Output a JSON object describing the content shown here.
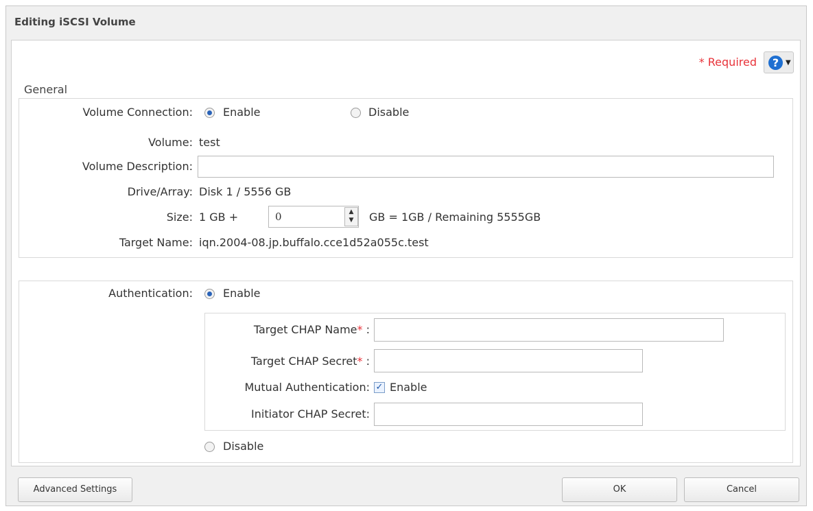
{
  "dialog": {
    "title": "Editing iSCSI Volume",
    "required_text": "Required",
    "required_star": "*",
    "help_icon": "question-circle-icon",
    "section_title": "General"
  },
  "general": {
    "volume_connection": {
      "label": "Volume Connection:",
      "enable_label": "Enable",
      "disable_label": "Disable",
      "selected": "Enable"
    },
    "volume": {
      "label": "Volume:",
      "value": "test"
    },
    "volume_description": {
      "label": "Volume Description:",
      "value": ""
    },
    "drive_array": {
      "label": "Drive/Array:",
      "value": "Disk 1 / 5556 GB"
    },
    "size": {
      "label": "Size:",
      "base": "1 GB +",
      "value": "0",
      "summary": "GB = 1GB / Remaining 5555GB"
    },
    "target_name": {
      "label": "Target Name:",
      "value": "iqn.2004-08.jp.buffalo.cce1d52a055c.test"
    }
  },
  "auth": {
    "label": "Authentication:",
    "enable_label": "Enable",
    "disable_label": "Disable",
    "selected": "Enable",
    "target_chap_name": {
      "label": "Target CHAP Name",
      "star": "*",
      "colon": ":",
      "value": ""
    },
    "target_chap_secret": {
      "label": "Target CHAP Secret",
      "star": "*",
      "colon": ":",
      "value": ""
    },
    "mutual": {
      "label": "Mutual Authentication:",
      "checkbox_label": "Enable",
      "checked": true
    },
    "initiator_chap_secret": {
      "label": "Initiator CHAP Secret:",
      "value": ""
    }
  },
  "footer": {
    "advanced_label": "Advanced Settings",
    "ok_label": "OK",
    "cancel_label": "Cancel"
  }
}
